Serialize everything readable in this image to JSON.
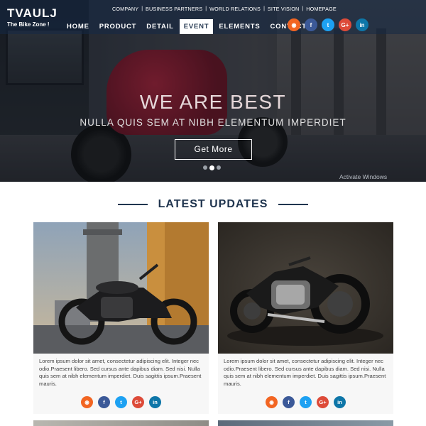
{
  "brand": {
    "name": "TVAULJ",
    "tagline": "The Bike Zone !"
  },
  "top_links": [
    "COMPANY",
    "BUSINESS PARTNERS",
    "WORLD RELATIONS",
    "SITE VISION",
    "HOMEPAGE"
  ],
  "menu": [
    {
      "label": "HOME",
      "active": false
    },
    {
      "label": "PRODUCT",
      "active": false
    },
    {
      "label": "DETAIL",
      "active": false
    },
    {
      "label": "EVENT",
      "active": true
    },
    {
      "label": "ELEMENTS",
      "active": false
    },
    {
      "label": "CONTACT",
      "active": false
    }
  ],
  "social": [
    {
      "icon": "rss-icon",
      "glyph": "◉",
      "color": "#f26522"
    },
    {
      "icon": "facebook-icon",
      "glyph": "f",
      "color": "#3b5998"
    },
    {
      "icon": "twitter-icon",
      "glyph": "t",
      "color": "#1da1f2"
    },
    {
      "icon": "google-plus-icon",
      "glyph": "G+",
      "color": "#dd4b39"
    },
    {
      "icon": "linkedin-icon",
      "glyph": "in",
      "color": "#0e76a8"
    }
  ],
  "hero": {
    "title": "WE ARE BEST",
    "subtitle": "NULLA QUIS SEM AT NIBH ELEMENTUM IMPERDIET",
    "button": "Get More",
    "active_slide": 2,
    "slides": 3,
    "watermark": "Activate Windows"
  },
  "section": {
    "title": "LATEST UPDATES"
  },
  "cards": [
    {
      "description": "Lorem ipsum dolor sit amet, consectetur adipiscing elit. Integer nec odio.Praesent libero. Sed cursus ante dapibus diam. Sed nisi. Nulla quis sem at nibh elementum imperdiet. Duis sagittis ipsum.Praesent mauris."
    },
    {
      "description": "Lorem ipsum dolor sit amet, consectetur adipiscing elit. Integer nec odio.Praesent libero. Sed cursus ante dapibus diam. Sed nisi. Nulla quis sem at nibh elementum imperdiet. Duis sagittis ipsum.Praesent mauris."
    }
  ],
  "colors": {
    "accent": "#20354f",
    "nav_bg": "rgba(20,40,70,0.55)"
  }
}
